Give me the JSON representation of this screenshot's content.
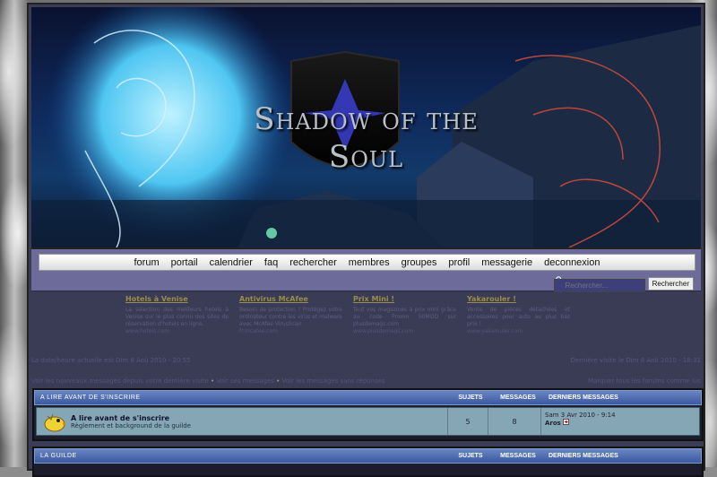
{
  "banner": {
    "title_line1": "Shadow of the",
    "title_line2": "Soul"
  },
  "nav": [
    {
      "label": "forum"
    },
    {
      "label": "portail"
    },
    {
      "label": "calendrier"
    },
    {
      "label": "faq"
    },
    {
      "label": "rechercher"
    },
    {
      "label": "membres"
    },
    {
      "label": "groupes"
    },
    {
      "label": "profil"
    },
    {
      "label": "messagerie"
    },
    {
      "label": "deconnexion"
    }
  ],
  "search": {
    "placeholder": "Rechercher...",
    "button": "Rechercher"
  },
  "ads": [
    {
      "title": "Hotels à Venise",
      "desc": "La sélection des meilleurs hotels à Venise sur le plus connu des sites de réservation d'hotels en ligne.",
      "url": "www.hotels.com"
    },
    {
      "title": "Antivirus McAfee",
      "desc": "Besoin de protection ? Protégez votre ordinateur contre les virus et malware avec McAfee VirusScan",
      "url": "fr.mcafee.com"
    },
    {
      "title": "Prix Mini !",
      "desc": "Tout vos magazines à prix mini grâce au code Promo 50MOD sur plusdemags.com",
      "url": "www.plusdemags.com"
    },
    {
      "title": "Yakarouler !",
      "desc": "Vente de pièces détachées et accessoires pour auto au plus bas prix !",
      "url": "www.yakarouler.com"
    }
  ],
  "meta": {
    "current_time": "La date/heure actuelle est Dim 8 Aoû 2010 - 20:55",
    "last_visit": "Dernière visite le Dim 8 Aoû 2010 - 18:31"
  },
  "links": {
    "new_posts": "Voir les nouveaux messages depuis votre dernière visite",
    "your_posts": "Voir ses messages",
    "unanswered": "Voir les messages sans réponses",
    "mark_read": "Marquer tous les forums comme lus"
  },
  "columns": {
    "topics": "Sujets",
    "messages": "Messages",
    "last": "Derniers Messages"
  },
  "categories": [
    {
      "name": "A lire avant de s'inscrire",
      "forums": [
        {
          "name": "A lire avant de s'inscrire",
          "desc": "Règlement et background de la guilde",
          "topics": "5",
          "posts": "8",
          "last_date": "Sam 3 Avr 2010 - 9:14",
          "last_user": "Aros"
        }
      ]
    },
    {
      "name": "La Guilde"
    }
  ],
  "colors": {
    "frame": "#3a3b55",
    "navbar": "#6c6b9a",
    "cat_head": "#3a58a0",
    "forum_row": "#85a6b5"
  }
}
